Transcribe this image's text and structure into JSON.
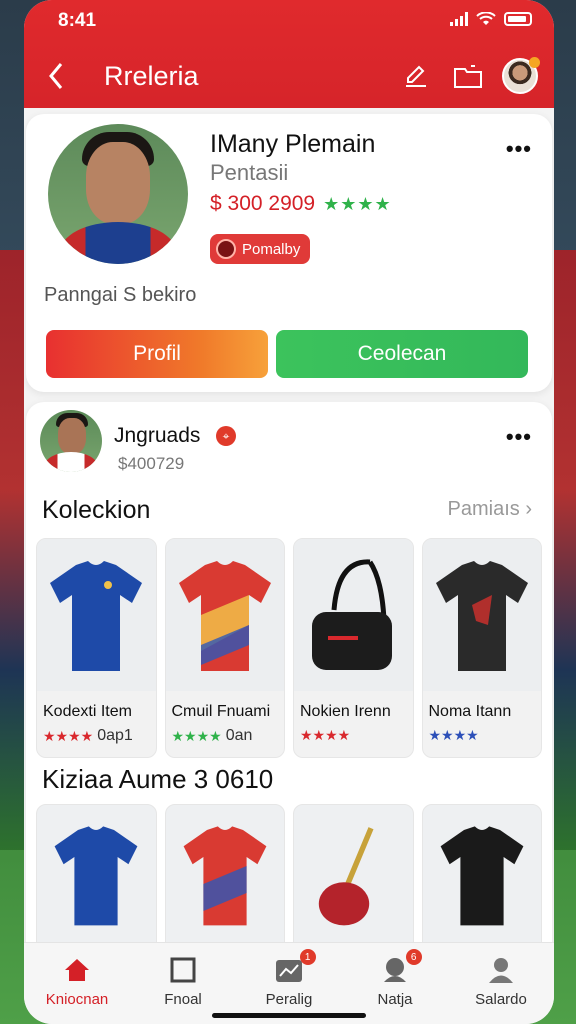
{
  "status": {
    "time": "8:41"
  },
  "header": {
    "title": "Rreleria"
  },
  "profile": {
    "name": "IMany Plemain",
    "subtitle": "Pentasii",
    "price": "$ 300 2909",
    "stars": "★★★★",
    "badge": "Pomalby",
    "description": "Panngai S bekiro",
    "btn_profil": "Profil",
    "btn_collect": "Ceolecan"
  },
  "feed": {
    "user_name": "Jngruads",
    "user_badge": "⌖",
    "user_price": "$400729",
    "collection_title": "Koleckion",
    "collection_link": "Pamiaıs",
    "items": [
      {
        "label": "Kodexti Item",
        "stars": "★★★★",
        "meta": "0ap1",
        "color": "#1e4aa8"
      },
      {
        "label": "Cmuil Fnuami",
        "stars": "★★★★",
        "meta": "0an",
        "color": "#d93a32"
      },
      {
        "label": "Nokien Irenn",
        "stars": "★★★★",
        "meta": "",
        "color": "#1c1c1c"
      },
      {
        "label": "Noma Itann",
        "stars": "★★★★",
        "meta": "",
        "color": "#2a2a2a"
      }
    ],
    "section2_title": "Kiziaa Aume 3 0610"
  },
  "tabs": [
    {
      "label": "Kniocnan",
      "active": true,
      "icon": "home-icon"
    },
    {
      "label": "Fnoal",
      "active": false,
      "icon": "square-icon"
    },
    {
      "label": "Peralig",
      "active": false,
      "icon": "chart-icon",
      "badge": "1"
    },
    {
      "label": "Natja",
      "active": false,
      "icon": "chat-icon",
      "badge": "6"
    },
    {
      "label": "Salardo",
      "active": false,
      "icon": "user-icon"
    }
  ],
  "colors": {
    "primary": "#d6242a",
    "accent_green": "#34b95a",
    "star_green": "#2fb24a"
  }
}
